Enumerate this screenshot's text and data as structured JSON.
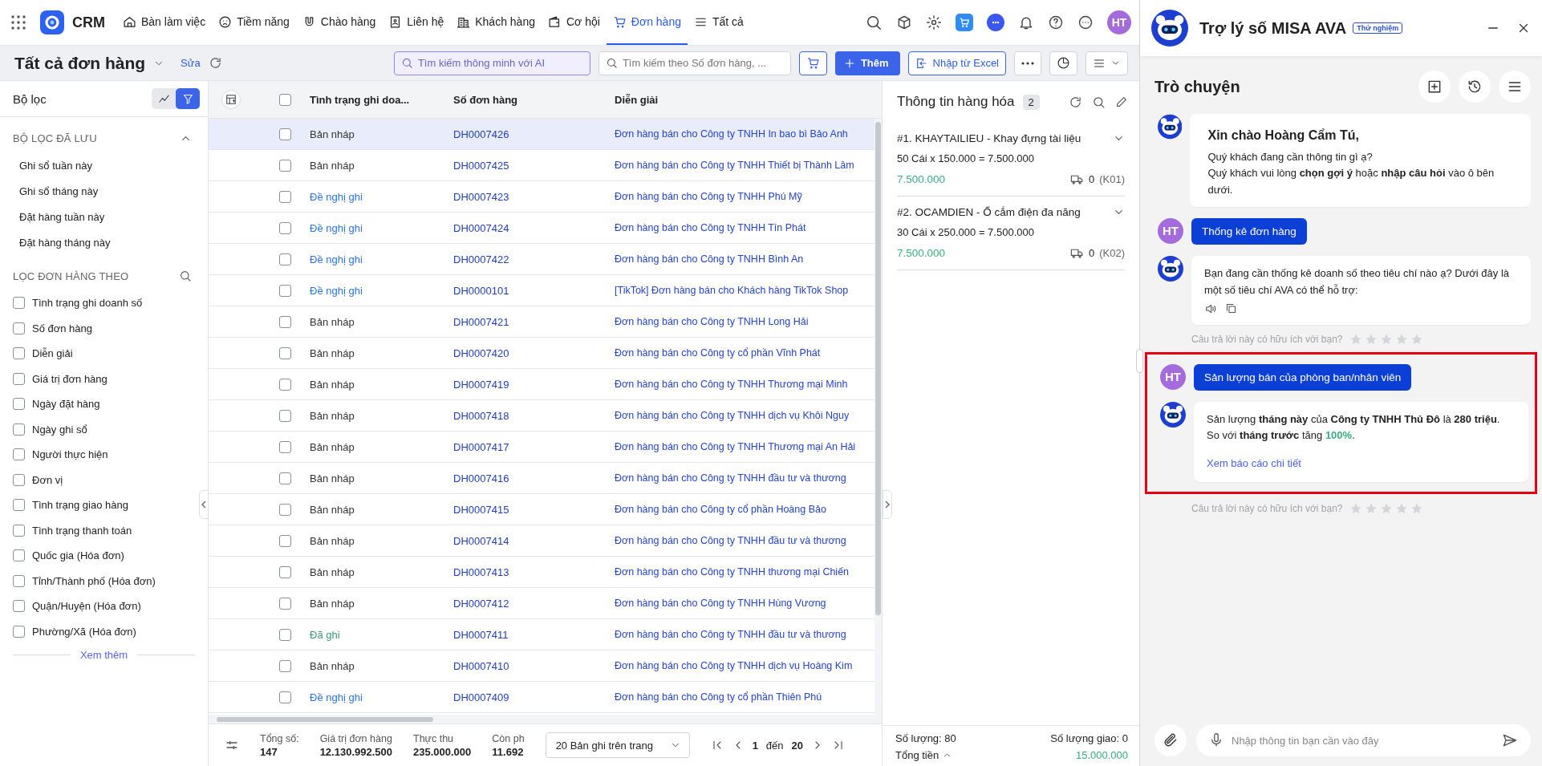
{
  "nav": {
    "brand": "CRM",
    "items": [
      {
        "label": "Bàn làm việc",
        "selected": false
      },
      {
        "label": "Tiềm năng",
        "selected": false
      },
      {
        "label": "Chào hàng",
        "selected": false
      },
      {
        "label": "Liên hệ",
        "selected": false
      },
      {
        "label": "Khách hàng",
        "selected": false
      },
      {
        "label": "Cơ hội",
        "selected": false
      },
      {
        "label": "Đơn hàng",
        "selected": true
      },
      {
        "label": "Tất cả",
        "selected": false
      }
    ],
    "avatar": "HT"
  },
  "toolbar": {
    "title": "Tất cả đơn hàng",
    "edit": "Sửa",
    "ai_search": {
      "placeholder": "Tìm kiếm thông minh với AI"
    },
    "search": {
      "placeholder": "Tìm kiếm theo Số đơn hàng, ..."
    },
    "add": "Thêm",
    "import": "Nhập từ Excel"
  },
  "filters": {
    "title": "Bộ lọc",
    "views": [
      {
        "kind": "chart",
        "selected": false
      },
      {
        "kind": "filter",
        "selected": true
      }
    ],
    "saved_title": "BỘ LỌC ĐÃ LƯU",
    "saved_expanded": true,
    "saved": [
      "Ghi sổ tuần này",
      "Ghi sổ tháng này",
      "Đặt hàng tuần này",
      "Đặt hàng tháng này"
    ],
    "by_title": "LỌC ĐƠN HÀNG THEO",
    "fields": [
      {
        "label": "Tình trạng ghi doanh số",
        "checked": false
      },
      {
        "label": "Số đơn hàng",
        "checked": false
      },
      {
        "label": "Diễn giải",
        "checked": false
      },
      {
        "label": "Giá trị đơn hàng",
        "checked": false
      },
      {
        "label": "Ngày đặt hàng",
        "checked": false
      },
      {
        "label": "Ngày ghi sổ",
        "checked": false
      },
      {
        "label": "Người thực hiện",
        "checked": false
      },
      {
        "label": "Đơn vị",
        "checked": false
      },
      {
        "label": "Tình trạng giao hàng",
        "checked": false
      },
      {
        "label": "Tình trạng thanh toán",
        "checked": false
      },
      {
        "label": "Quốc gia (Hóa đơn)",
        "checked": false
      },
      {
        "label": "Tỉnh/Thành phố (Hóa đơn)",
        "checked": false
      },
      {
        "label": "Quận/Huyện (Hóa đơn)",
        "checked": false
      },
      {
        "label": "Phường/Xã (Hóa đơn)",
        "checked": false
      }
    ],
    "more": "Xem thêm"
  },
  "table": {
    "all_checked": false,
    "columns": [
      "Tình trạng ghi doa...",
      "Số đơn hàng",
      "Diễn giải"
    ],
    "rows": [
      {
        "selected": true,
        "checked": false,
        "status": "Bản nháp",
        "kind": "draft",
        "number": "DH0007426",
        "description": "Đơn hàng bán cho Công ty TNHH In bao bì Bảo Anh"
      },
      {
        "selected": false,
        "checked": false,
        "status": "Bản nháp",
        "kind": "draft",
        "number": "DH0007425",
        "description": "Đơn hàng bán cho Công ty TNHH Thiết bị Thành Lâm"
      },
      {
        "selected": false,
        "checked": false,
        "status": "Đề nghị ghi",
        "kind": "proposed",
        "number": "DH0007423",
        "description": "Đơn hàng bán cho Công ty TNHH Phú Mỹ"
      },
      {
        "selected": false,
        "checked": false,
        "status": "Đề nghị ghi",
        "kind": "proposed",
        "number": "DH0007424",
        "description": "Đơn hàng bán cho Công ty TNHH Tín Phát"
      },
      {
        "selected": false,
        "checked": false,
        "status": "Đề nghị ghi",
        "kind": "proposed",
        "number": "DH0007422",
        "description": "Đơn hàng bán cho Công ty TNHH Bình An"
      },
      {
        "selected": false,
        "checked": false,
        "status": "Đề nghị ghi",
        "kind": "proposed",
        "number": "DH0000101",
        "description": "[TikTok] Đơn hàng bán cho Khách hàng TikTok Shop"
      },
      {
        "selected": false,
        "checked": false,
        "status": "Bản nháp",
        "kind": "draft",
        "number": "DH0007421",
        "description": "Đơn hàng bán cho Công ty TNHH Long Hải"
      },
      {
        "selected": false,
        "checked": false,
        "status": "Bản nháp",
        "kind": "draft",
        "number": "DH0007420",
        "description": "Đơn hàng bán cho Công ty cổ phần Vĩnh Phát"
      },
      {
        "selected": false,
        "checked": false,
        "status": "Bản nháp",
        "kind": "draft",
        "number": "DH0007419",
        "description": "Đơn hàng bán cho Công ty TNHH Thương mại Minh"
      },
      {
        "selected": false,
        "checked": false,
        "status": "Bản nháp",
        "kind": "draft",
        "number": "DH0007418",
        "description": "Đơn hàng bán cho Công ty TNHH dịch vụ Khôi Nguy"
      },
      {
        "selected": false,
        "checked": false,
        "status": "Bản nháp",
        "kind": "draft",
        "number": "DH0007417",
        "description": "Đơn hàng bán cho Công ty TNHH Thương mại An Hải"
      },
      {
        "selected": false,
        "checked": false,
        "status": "Bản nháp",
        "kind": "draft",
        "number": "DH0007416",
        "description": "Đơn hàng bán cho Công ty TNHH đầu tư và thương"
      },
      {
        "selected": false,
        "checked": false,
        "status": "Bản nháp",
        "kind": "draft",
        "number": "DH0007415",
        "description": "Đơn hàng bán cho Công ty cổ phần Hoàng Bảo"
      },
      {
        "selected": false,
        "checked": false,
        "status": "Bản nháp",
        "kind": "draft",
        "number": "DH0007414",
        "description": "Đơn hàng bán cho Công ty TNHH đầu tư và thương"
      },
      {
        "selected": false,
        "checked": false,
        "status": "Bản nháp",
        "kind": "draft",
        "number": "DH0007413",
        "description": "Đơn hàng bán cho Công ty TNHH thương mại Chiến"
      },
      {
        "selected": false,
        "checked": false,
        "status": "Bản nháp",
        "kind": "draft",
        "number": "DH0007412",
        "description": "Đơn hàng bán cho Công ty TNHH Hùng Vương"
      },
      {
        "selected": false,
        "checked": false,
        "status": "Đã ghi",
        "kind": "recorded",
        "number": "DH0007411",
        "description": "Đơn hàng bán cho Công ty TNHH đầu tư và thương"
      },
      {
        "selected": false,
        "checked": false,
        "status": "Bản nháp",
        "kind": "draft",
        "number": "DH0007410",
        "description": "Đơn hàng bán cho Công ty TNHH dịch vụ Hoàng Kim"
      },
      {
        "selected": false,
        "checked": false,
        "status": "Đề nghị ghi",
        "kind": "proposed",
        "number": "DH0007409",
        "description": "Đơn hàng bán cho Công ty cổ phần Thiên Phú"
      }
    ]
  },
  "footer": {
    "totals": [
      {
        "label": "Tổng số:",
        "value": "147"
      },
      {
        "label": "Giá trị đơn hàng",
        "value": "12.130.992.500"
      },
      {
        "label": "Thực thu",
        "value": "235.000.000"
      },
      {
        "label": "Còn ph",
        "value": "11.692"
      }
    ],
    "page_size": "20 Bản ghi trên trang",
    "page": "1",
    "to": "đến",
    "pages": "20"
  },
  "products": {
    "title": "Thông tin hàng hóa",
    "count": "2",
    "items": [
      {
        "title": "#1. KHAYTAILIEU - Khay đựng tài liệu",
        "formula": "50 Cái x 150.000 = 7.500.000",
        "amount": "7.500.000",
        "delivered": "0",
        "warehouse": "(K01)"
      },
      {
        "title": "#2. OCAMDIEN - Ổ cắm điện đa năng",
        "formula": "30 Cái x 250.000 = 7.500.000",
        "amount": "7.500.000",
        "delivered": "0",
        "warehouse": "(K02)"
      }
    ],
    "quantity": "Số lượng: 80",
    "delivered": "Số lượng giao: 0",
    "total_label": "Tổng tiền",
    "total": "15.000.000"
  },
  "chat": {
    "title": "Trợ lý số MISA AVA",
    "badge": "Thử nghiệm",
    "heading": "Trò chuyện",
    "messages": [
      {
        "kind": "greeting",
        "highlighted": false,
        "title": "Xin chào Hoàng Cẩm Tú,",
        "lines": [
          "Quý khách đang cần thông tin gì ạ?",
          "Quý khách vui lòng **chọn gợi ý** hoặc **nhập câu hỏi** vào ô bên dưới."
        ]
      },
      {
        "kind": "user",
        "highlighted": false,
        "avatar": "HT",
        "text": "Thống kê đơn hàng"
      },
      {
        "kind": "bot",
        "highlighted": false,
        "text": "Bạn đang cần thống kê doanh số theo tiêu chí nào ạ? Dưới đây là một số tiêu chí AVA có thể hỗ trợ:"
      },
      {
        "kind": "feedback",
        "highlighted": false,
        "text": "Câu trả lời này có hữu ích với bạn?",
        "stars": 0
      },
      {
        "kind": "user",
        "highlighted": true,
        "avatar": "HT",
        "text": "Sản lượng bán của phòng ban/nhân viên"
      },
      {
        "kind": "answer",
        "highlighted": true,
        "lines": [
          "Sản lượng **tháng này** của **Công ty TNHH Thủ Đô** là **280 triệu**.",
          "So với **tháng trước** tăng"
        ],
        "change": "100%",
        "end": ".",
        "link": "Xem báo cáo chi tiết"
      },
      {
        "kind": "feedback",
        "highlighted": false,
        "text": "Câu trả lời này có hữu ích với bạn?",
        "stars": 0
      }
    ],
    "input": {
      "placeholder": "Nhập thông tin bạn cần vào đây"
    }
  }
}
